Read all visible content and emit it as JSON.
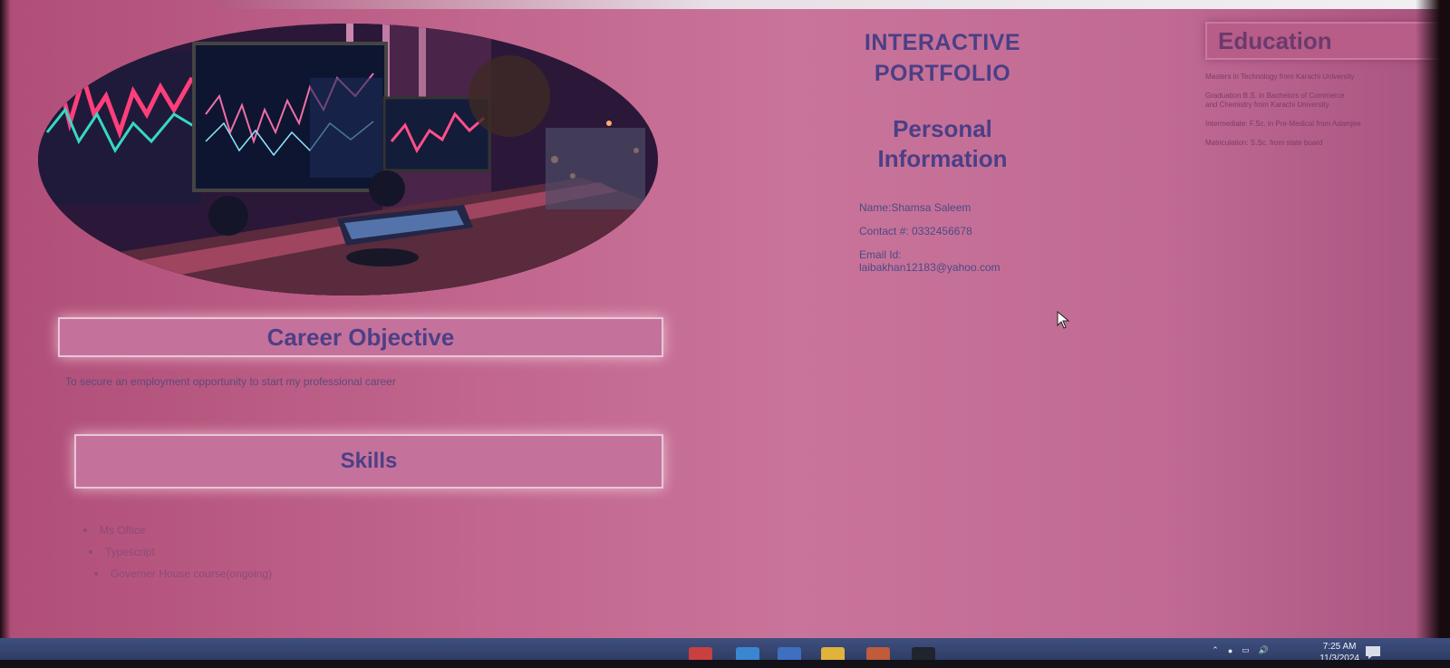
{
  "page": {
    "title_line1": "INTERACTIVE",
    "title_line2": "PORTFOLIO"
  },
  "personal": {
    "heading_line1": "Personal",
    "heading_line2": "Information",
    "name": "Name:Shamsa Saleem",
    "contact": "Contact #: 0332456678",
    "email_label": "Email Id:",
    "email_value": "laibakhan12183@yahoo.com"
  },
  "career": {
    "heading": "Career Objective",
    "text": "To secure an employment opportunity to start my professional career"
  },
  "skills": {
    "heading": "Skills",
    "items": [
      "Ms Office",
      "Typescript",
      "Governer House course(ongoing)"
    ]
  },
  "education": {
    "heading": "Education",
    "items": [
      "Masters in Technology from Karachi University",
      "Graduation B.S. in Bachelors of Commerce",
      "and Chemistry from Karachi University",
      "Intermediate: F.Sc. in Pre-Medical from Adamjee",
      "Matriculation: S.Sc. from state board"
    ]
  },
  "taskbar": {
    "time": "7:25 AM",
    "date": "11/3/2024"
  },
  "colors": {
    "heading": "#4b3f86",
    "background": "#c2678f",
    "section_bar": "#c4729c",
    "taskbar": "#2f3b63"
  },
  "icons": [
    "mouse-cursor-icon",
    "chevron-up-icon",
    "battery-icon",
    "volume-icon",
    "notification-icon"
  ]
}
